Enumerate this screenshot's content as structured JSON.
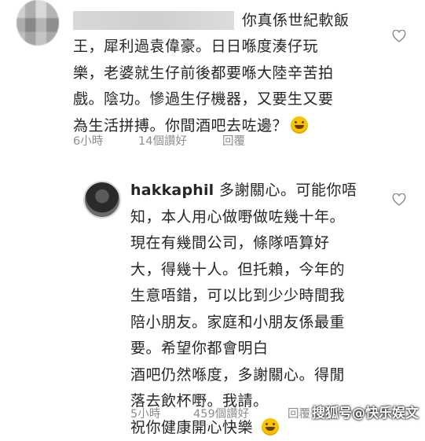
{
  "comments": [
    {
      "first_line": "你真係世紀軟飯",
      "lines": [
        "王，犀利過袁偉豪。日日喺度湊仔玩",
        "樂，老婆就生仔前後都要喺大陸辛苦拍",
        "戲。陰功。慘過生仔機器，又要生又要",
        "為生活拼搏。你間酒吧去咗邊？"
      ],
      "emoji": "laughing-tears",
      "time": "6小時",
      "likes": "14個讚好",
      "reply": "回覆"
    },
    {
      "username": "hakkaphil",
      "lines": [
        " 多謝關心。可能你唔",
        "知，本人用心做嘢做咗幾十年。",
        "現在有幾間公司，條隊唔算好",
        "大，得幾十人。但托賴，今年的",
        "生意唔錯，可以比到少少時間我",
        "陪小朋友。家庭和小朋友係最重",
        "要。希望你都會明白",
        "酒吧仍然喺度，多謝關心。得閒",
        "落去飲杯嘢。我請。",
        "祝你健康開心快樂"
      ],
      "emoji": "smiling-face",
      "time": "5小時",
      "likes": "459個讚好",
      "reply": "回覆"
    }
  ],
  "watermark": "搜狐号@快乐娱文",
  "icons": {
    "like": "heart-outline-icon"
  }
}
